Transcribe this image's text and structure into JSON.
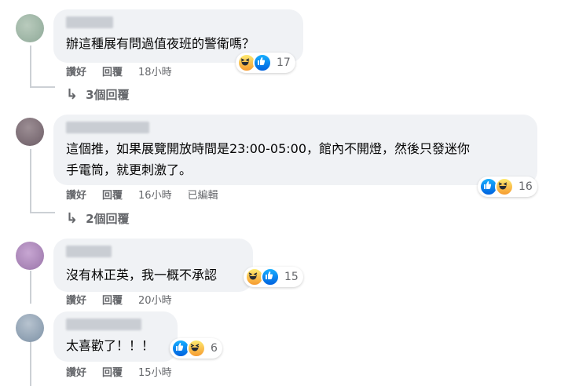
{
  "comments": [
    {
      "text": [
        "辦這種展有問過值夜班的警衛嗎？"
      ],
      "like_label": "讚好",
      "reply_label": "回覆",
      "time": "18小時",
      "reactions": [
        "haha",
        "like"
      ],
      "reaction_count": "17",
      "replies_label": "3個回覆"
    },
    {
      "text": [
        "這個推，如果展覽開放時間是23:00-05:00，館內不開燈，然後只發迷你",
        "手電筒，就更刺激了。"
      ],
      "like_label": "讚好",
      "reply_label": "回覆",
      "time": "16小時",
      "edited": "已編輯",
      "reactions": [
        "like",
        "haha"
      ],
      "reaction_count": "16",
      "replies_label": "2個回覆"
    },
    {
      "text": [
        "沒有林正英，我一概不承認"
      ],
      "like_label": "讚好",
      "reply_label": "回覆",
      "time": "20小時",
      "reactions": [
        "haha",
        "like"
      ],
      "reaction_count": "15"
    },
    {
      "text": [
        "太喜歡了！！！"
      ],
      "like_label": "讚好",
      "reply_label": "回覆",
      "time": "15小時",
      "reactions": [
        "like",
        "haha"
      ],
      "reaction_count": "6"
    }
  ],
  "colors": {
    "like": "#1877f2",
    "haha": "#f7b125",
    "bubble": "#f0f2f5",
    "meta": "#65676b"
  }
}
